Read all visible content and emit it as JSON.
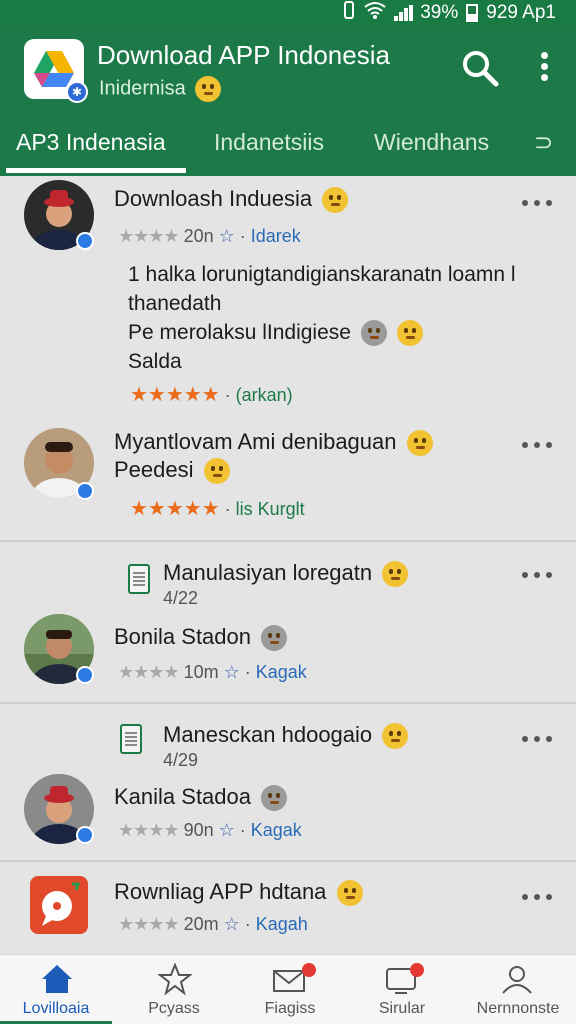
{
  "status_bar": {
    "battery": "39%",
    "time": "929 Ap1"
  },
  "app_bar": {
    "title": "Download APP Indonesia",
    "subtitle": "Inidernisa",
    "tabs": [
      {
        "label": "AP3 Indenasia",
        "active": true
      },
      {
        "label": "Indanetsiis",
        "active": false
      },
      {
        "label": "Wiendhans",
        "active": false
      },
      {
        "label": "⊃",
        "active": false
      }
    ]
  },
  "items": [
    {
      "name": "Downloash Induesia",
      "time": "20n",
      "tag": "Idarek",
      "body": [
        "1 halka lorunigtandigianskaranatn loamn l",
        "thanedath",
        "Pe merolaksu lIndigiese",
        "Salda"
      ],
      "rating_tag": "(arkan)"
    },
    {
      "name": "Myantlovam Ami denibaguan",
      "name2": "Peedesi",
      "rating_tag": "lis Kurglt"
    },
    {
      "post_title": "Manulasiyan loregatn",
      "date": "4/22",
      "name": "Bonila Stadon",
      "time": "10m",
      "tag": "Kagak"
    },
    {
      "post_title": "Manesckan hdoogaio",
      "date": "4/29",
      "name": "Kanila Stadoa",
      "time": "90n",
      "tag": "Kagak"
    },
    {
      "name": "Rownliag APP hdtana",
      "time": "20m",
      "tag": "Kagah"
    }
  ],
  "bottom_nav": [
    {
      "label": "Lovilloaia",
      "icon": "home-icon",
      "active": true
    },
    {
      "label": "Pcyass",
      "icon": "star-icon",
      "active": false
    },
    {
      "label": "Fiagiss",
      "icon": "mail-icon",
      "active": false
    },
    {
      "label": "Sirular",
      "icon": "screen-icon",
      "active": false
    },
    {
      "label": "Nernnonste",
      "icon": "person-icon",
      "active": false
    }
  ],
  "colors": {
    "primary": "#1d7a48",
    "accent_blue": "#1d5bb8",
    "star_orange": "#ea6b1a"
  }
}
